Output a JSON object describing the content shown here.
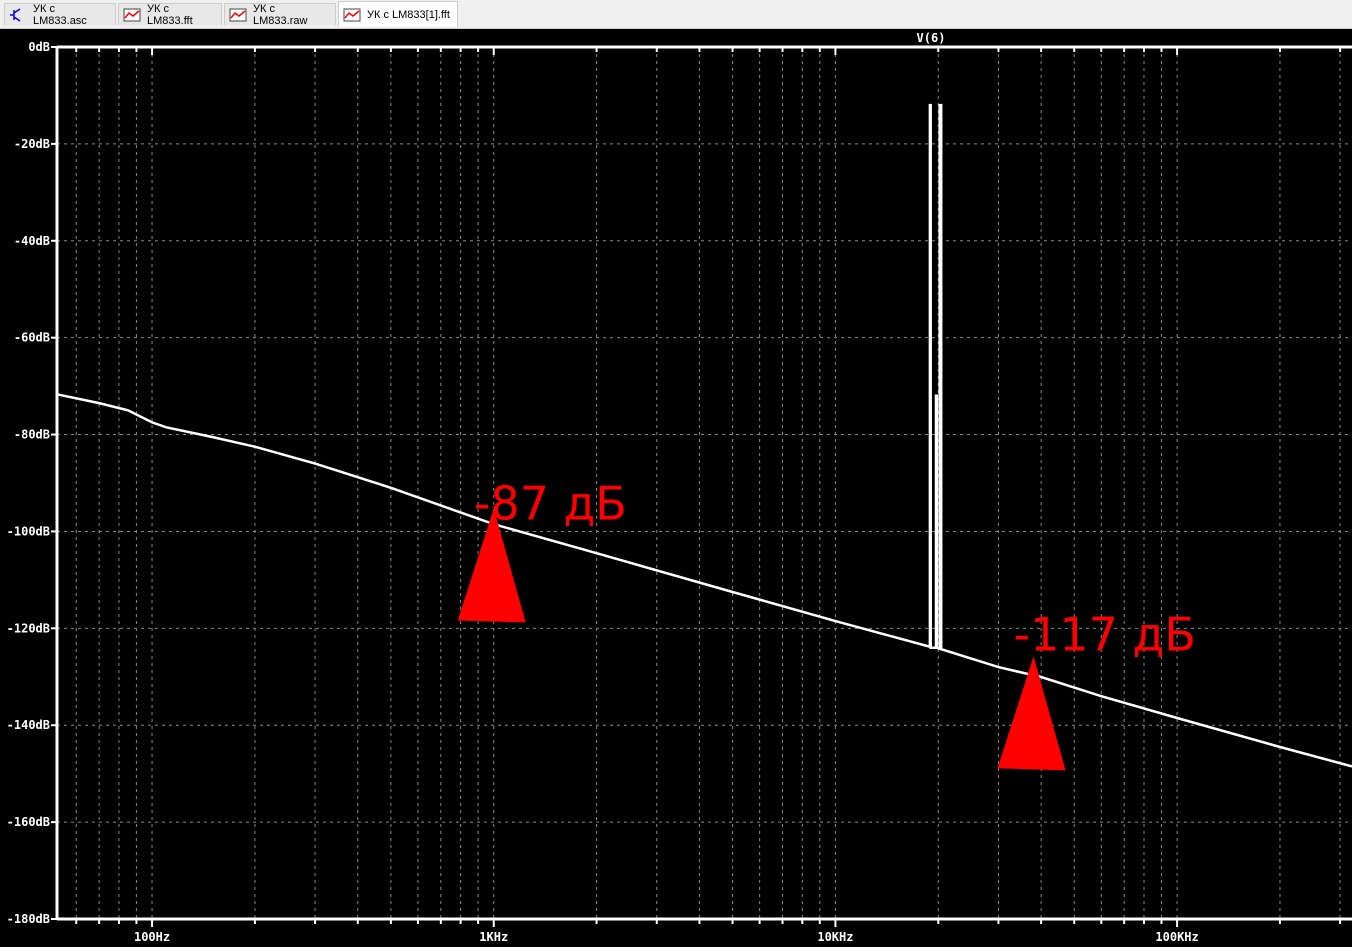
{
  "tabs": [
    {
      "label": "УК с LM833.asc",
      "icon": "schematic-icon"
    },
    {
      "label": "УК с LM833.fft",
      "icon": "waveform-icon"
    },
    {
      "label": "УК с LM833.raw",
      "icon": "waveform-icon"
    },
    {
      "label": "УК с LM833[1].fft",
      "icon": "waveform-icon",
      "active": true
    }
  ],
  "chart_data": {
    "type": "line",
    "title": "V(6)",
    "xscale": "log",
    "xlim": [
      52.7,
      325000
    ],
    "ylim": [
      -180,
      0
    ],
    "grid": true,
    "y_ticks": [
      0,
      -20,
      -40,
      -60,
      -80,
      -100,
      -120,
      -140,
      -160,
      -180
    ],
    "y_tick_labels": [
      "0dB",
      "-20dB",
      "-40dB",
      "-60dB",
      "-80dB",
      "-100dB",
      "-120dB",
      "-140dB",
      "-160dB",
      "-180dB"
    ],
    "x_ticks": [
      100,
      1000,
      10000,
      100000
    ],
    "x_tick_labels": [
      "100Hz",
      "1KHz",
      "10KHz",
      "100KHz"
    ],
    "series": [
      {
        "name": "V(6)",
        "color": "#ffffff",
        "points": [
          [
            52.7,
            -71.7
          ],
          [
            70,
            -73.5
          ],
          [
            85,
            -75
          ],
          [
            100,
            -77.5
          ],
          [
            110,
            -78.5
          ],
          [
            150,
            -80.5
          ],
          [
            200,
            -82.5
          ],
          [
            300,
            -86
          ],
          [
            500,
            -91
          ],
          [
            1000,
            -98.5
          ],
          [
            2000,
            -104.5
          ],
          [
            5000,
            -112.5
          ],
          [
            10000,
            -118.5
          ],
          [
            18900,
            -123.8
          ],
          [
            18900,
            -12
          ],
          [
            19000,
            -12
          ],
          [
            19000,
            -124
          ],
          [
            19700,
            -124
          ],
          [
            19700,
            -72
          ],
          [
            19800,
            -72
          ],
          [
            19800,
            -124
          ],
          [
            20200,
            -124.2
          ],
          [
            20200,
            -12
          ],
          [
            20400,
            -12
          ],
          [
            20400,
            -124.3
          ],
          [
            30000,
            -128
          ],
          [
            37000,
            -129.5
          ],
          [
            38000,
            -128
          ],
          [
            39000,
            -129.8
          ],
          [
            60000,
            -134
          ],
          [
            100000,
            -138.5
          ],
          [
            200000,
            -144.5
          ],
          [
            325000,
            -148.5
          ]
        ]
      }
    ],
    "annotations": [
      {
        "text": "-87 дБ",
        "x": 1000,
        "y": -93
      },
      {
        "text": "-117 дБ",
        "x": 38000,
        "y": -120
      }
    ],
    "annotation_color": "#ff0000"
  }
}
